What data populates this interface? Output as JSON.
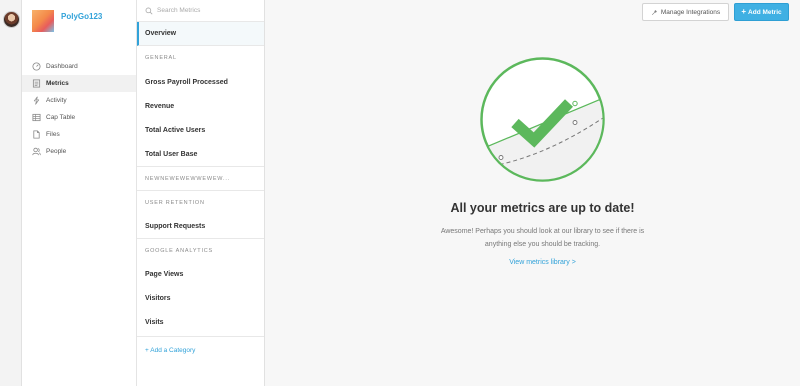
{
  "company": {
    "name": "PolyGo123"
  },
  "nav": {
    "items": [
      {
        "label": "Dashboard",
        "icon": "dashboard-icon"
      },
      {
        "label": "Metrics",
        "icon": "metrics-icon",
        "active": true
      },
      {
        "label": "Activity",
        "icon": "activity-icon"
      },
      {
        "label": "Cap Table",
        "icon": "cap-table-icon"
      },
      {
        "label": "Files",
        "icon": "files-icon"
      },
      {
        "label": "People",
        "icon": "people-icon"
      }
    ]
  },
  "metrics_panel": {
    "search_placeholder": "Search Metrics",
    "overview": "Overview",
    "general_header": "General",
    "general_items": [
      "Gross Payroll Processed",
      "Revenue",
      "Total Active Users",
      "Total User Base"
    ],
    "newcat_header": "NEWNEWEWEWWEWEW...",
    "retention_header": "User Retention",
    "retention_items": [
      "Support Requests"
    ],
    "ga_header": "Google Analytics",
    "ga_items": [
      "Page Views",
      "Visitors",
      "Visits"
    ],
    "add_category": "+ Add a Category"
  },
  "toolbar": {
    "integrations_label": "Manage Integrations",
    "add_metric_label": "Add Metric"
  },
  "empty_state": {
    "title": "All your metrics are up to date!",
    "description": "Awesome! Perhaps you should look at our library to see if there is anything else you should be tracking.",
    "link": "View metrics library >"
  },
  "colors": {
    "accent": "#31a2d9",
    "button_primary": "#3fb0e3",
    "check_green": "#5cb85c"
  }
}
